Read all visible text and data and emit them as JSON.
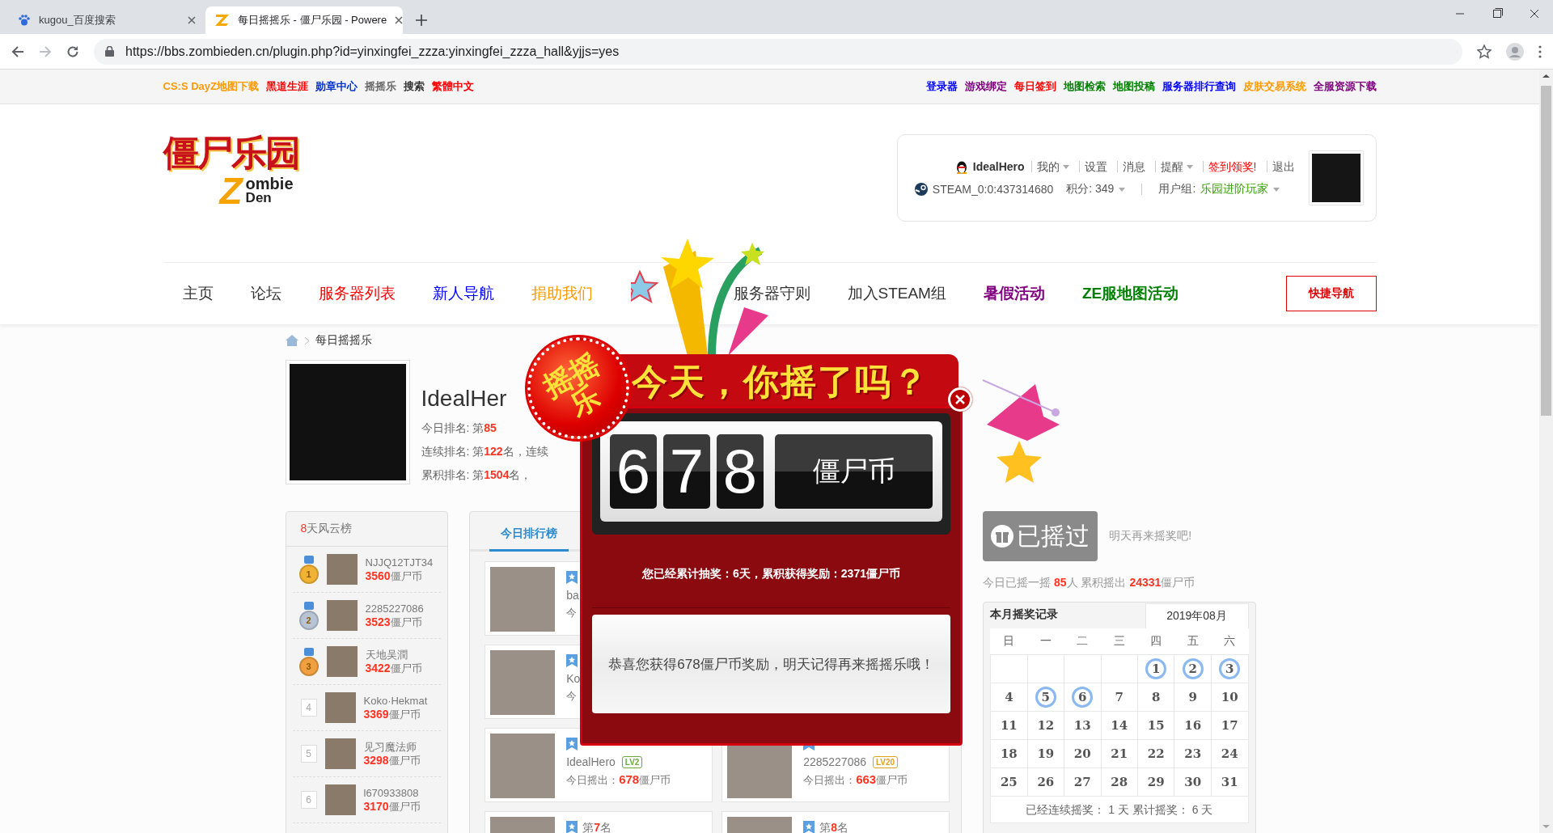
{
  "browser": {
    "tabs": [
      {
        "title": "kugou_百度搜索",
        "selected": false
      },
      {
        "title": "每日摇摇乐 - 僵尸乐园 - Powere",
        "selected": true
      }
    ],
    "url": "https://bbs.zombieden.cn/plugin.php?id=yinxingfei_zzza:yinxingfei_zzza_hall&yjjs=yes"
  },
  "topbar": {
    "left": [
      {
        "label": "CS:S DayZ地图下载",
        "color": "#ff9900"
      },
      {
        "label": "黑道生涯",
        "color": "#ff0000"
      },
      {
        "label": "勋章中心",
        "color": "#0033cc"
      },
      {
        "label": "摇摇乐",
        "color": "#666666"
      },
      {
        "label": "搜索",
        "color": "#333333"
      },
      {
        "label": "繁體中文",
        "color": "#ff0000"
      }
    ],
    "right": [
      {
        "label": "登录器",
        "color": "#0000ff"
      },
      {
        "label": "游戏绑定",
        "color": "#800080"
      },
      {
        "label": "每日签到",
        "color": "#ff0000"
      },
      {
        "label": "地图检索",
        "color": "#008000"
      },
      {
        "label": "地图投稿",
        "color": "#008000"
      },
      {
        "label": "服务器排行查询",
        "color": "#0000ff"
      },
      {
        "label": "皮肤交易系统",
        "color": "#ff9900"
      },
      {
        "label": "全服资源下载",
        "color": "#800080"
      }
    ]
  },
  "logo": {
    "title": "僵尸乐园",
    "letter": "Z",
    "line_1": "ombie",
    "line_2": "Den"
  },
  "user": {
    "name": "IdealHero",
    "menu": [
      {
        "label": "我的",
        "dropdown": true,
        "color": "#555555"
      },
      {
        "label": "设置",
        "dropdown": false,
        "color": "#555555"
      },
      {
        "label": "消息",
        "dropdown": false,
        "color": "#555555"
      },
      {
        "label": "提醒",
        "dropdown": true,
        "color": "#555555"
      },
      {
        "label": "签到领奖!",
        "dropdown": false,
        "color": "#ff0000"
      },
      {
        "label": "退出",
        "dropdown": false,
        "color": "#555555"
      }
    ],
    "steam_id": "STEAM_0:0:437314680",
    "points": "积分: 349",
    "group_label": "用户组: ",
    "group": "乐园进阶玩家"
  },
  "nav": {
    "items": [
      {
        "label": "主页",
        "color": "#333333",
        "bold": false
      },
      {
        "label": "论坛",
        "color": "#333333",
        "bold": false
      },
      {
        "label": "服务器列表",
        "color": "#ff0000",
        "bold": false
      },
      {
        "label": "新人导航",
        "color": "#0000ff",
        "bold": false
      },
      {
        "label": "捐助我们",
        "color": "#ff9900",
        "bold": false
      },
      {
        "label": "服务器守则",
        "color": "#333333",
        "bold": false
      },
      {
        "label": "加入STEAM组",
        "color": "#333333",
        "bold": false
      },
      {
        "label": "暑假活动",
        "color": "#800080",
        "bold": true
      },
      {
        "label": "ZE服地图活动",
        "color": "#008000",
        "bold": true
      }
    ],
    "quick": "快捷导航"
  },
  "breadcrumb": "每日摇摇乐",
  "profile": {
    "name": "IdealHer",
    "lines": [
      "今日排名: 第**85**",
      "连续排名: 第**122**名，连续",
      "累积排名: 第**1504**名，"
    ]
  },
  "leaderboard": {
    "title_number": "8",
    "title": "天风云榜",
    "entries": [
      {
        "rank": "1",
        "kind": "medal",
        "color": "#f2b234",
        "name": "NJJQ12TJT34",
        "coins": "3560",
        "unit": "僵尸币"
      },
      {
        "rank": "2",
        "kind": "medal",
        "color": "#b8c4d4",
        "name": "2285227086",
        "coins": "3523",
        "unit": "僵尸币"
      },
      {
        "rank": "3",
        "kind": "medal",
        "color": "#f0a040",
        "name": "天地吴潤",
        "coins": "3422",
        "unit": "僵尸币"
      },
      {
        "rank": "4",
        "kind": "plain",
        "name": "Koko·Hekmat",
        "coins": "3369",
        "unit": "僵尸币"
      },
      {
        "rank": "5",
        "kind": "plain",
        "name": "见习魔法师",
        "coins": "3298",
        "unit": "僵尸币"
      },
      {
        "rank": "6",
        "kind": "plain",
        "name": "l670933808",
        "coins": "3170",
        "unit": "僵尸币"
      }
    ]
  },
  "today": {
    "tab": "今日排行榜",
    "rows": [
      {
        "left": {
          "name": "ba",
          "label": "今"
        }
      },
      {
        "left": {
          "name": "Ko",
          "label": "今"
        }
      },
      {
        "left": {
          "name": "IdealHero",
          "level": "LV2",
          "color": "#6aaa3a",
          "label": "今日摇出：",
          "amount": "678",
          "unit": "僵尸币"
        },
        "right": {
          "name": "2285227086",
          "level": "LV20",
          "color": "#e0a020",
          "label": "今日摇出：",
          "amount": "663",
          "unit": "僵尸币"
        }
      },
      {
        "left": {
          "rank": "第**7**名"
        },
        "right": {
          "rank": "第**8**名"
        }
      }
    ]
  },
  "shake": {
    "button": "已摇过",
    "disabled": true,
    "note": "明天再来摇奖吧!",
    "stats": "今日已摇一摇 **85**人 累积摇出 **24331**僵尸币"
  },
  "calendar": {
    "title": "本月摇奖记录",
    "month": "2019年08月",
    "weekdays": [
      "日",
      "一",
      "二",
      "三",
      "四",
      "五",
      "六"
    ],
    "weeks": [
      [
        {
          "day": "1",
          "signed": true
        },
        {
          "day": "2",
          "signed": true
        },
        {
          "day": "3",
          "signed": true
        }
      ],
      [
        {
          "day": "4",
          "signed": false
        },
        {
          "day": "5",
          "signed": true
        },
        {
          "day": "6",
          "signed": true
        },
        {
          "day": "7",
          "signed": false
        },
        {
          "day": "8",
          "signed": false
        },
        {
          "day": "9",
          "signed": false
        },
        {
          "day": "10",
          "signed": false
        }
      ],
      [
        {
          "day": "11",
          "signed": false
        },
        {
          "day": "12",
          "signed": false
        },
        {
          "day": "13",
          "signed": false
        },
        {
          "day": "14",
          "signed": false
        },
        {
          "day": "15",
          "signed": false
        },
        {
          "day": "16",
          "signed": false
        },
        {
          "day": "17",
          "signed": false
        }
      ],
      [
        {
          "day": "18",
          "signed": false
        },
        {
          "day": "19",
          "signed": false
        },
        {
          "day": "20",
          "signed": false
        },
        {
          "day": "21",
          "signed": false
        },
        {
          "day": "22",
          "signed": false
        },
        {
          "day": "23",
          "signed": false
        },
        {
          "day": "24",
          "signed": false
        }
      ],
      [
        {
          "day": "25",
          "signed": false
        },
        {
          "day": "26",
          "signed": false
        },
        {
          "day": "27",
          "signed": false
        },
        {
          "day": "28",
          "signed": false
        },
        {
          "day": "29",
          "signed": false
        },
        {
          "day": "30",
          "signed": false
        },
        {
          "day": "31",
          "signed": false
        }
      ]
    ],
    "footer": "已经连续摇奖： 1 天 累计摇奖： 6 天"
  },
  "popup": {
    "badge": "摇摇乐",
    "title": "今天，你摇了吗？",
    "digits": [
      "6",
      "7",
      "8"
    ],
    "unit": "僵尸币",
    "summary": "您已经累计抽奖：6天，累积获得奖励：2371僵尸币",
    "message": "恭喜您获得678僵尸币奖励，明天记得再来摇摇乐哦！"
  }
}
